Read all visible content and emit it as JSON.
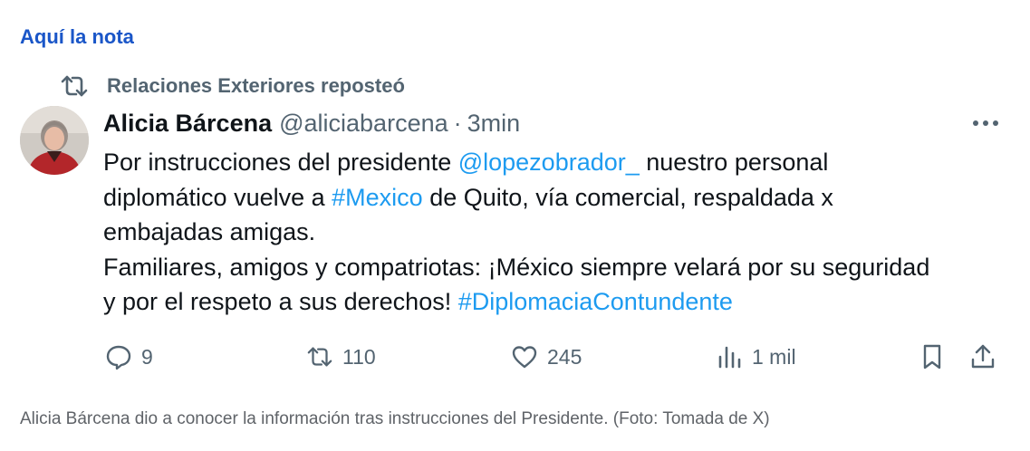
{
  "note_link": "Aquí la nota",
  "repost": {
    "text": "Relaciones Exteriores reposteó",
    "icon": "repost-icon"
  },
  "tweet": {
    "author_name": "Alicia Bárcena",
    "author_handle": "@aliciabarcena",
    "separator": "·",
    "time": "3min",
    "more_icon": "more-icon",
    "text": {
      "l1_a": "Por instrucciones del presidente ",
      "l1_mention": "@lopezobrador_",
      "l1_b": " nuestro personal",
      "l2_a": "diplomático vuelve a ",
      "l2_hashtag": "#Mexico",
      "l2_b": " de Quito, vía comercial, respaldada x",
      "l3": "embajadas amigas.",
      "l4": "Familiares, amigos y compatriotas: ¡México siempre velará por su seguridad",
      "l5_a": "y por el respeto a sus derechos! ",
      "l5_hashtag": "#DiplomaciaContundente"
    },
    "actions": {
      "replies": "9",
      "reposts": "110",
      "likes": "245",
      "views": "1 mil"
    }
  },
  "caption": "Alicia Bárcena dio a conocer la información tras instrucciones del Presidente. (Foto: Tomada de X)",
  "colors": {
    "link": "#1a56c8",
    "accent": "#1d9bf0",
    "muted": "#536471",
    "text": "#0f1419"
  }
}
